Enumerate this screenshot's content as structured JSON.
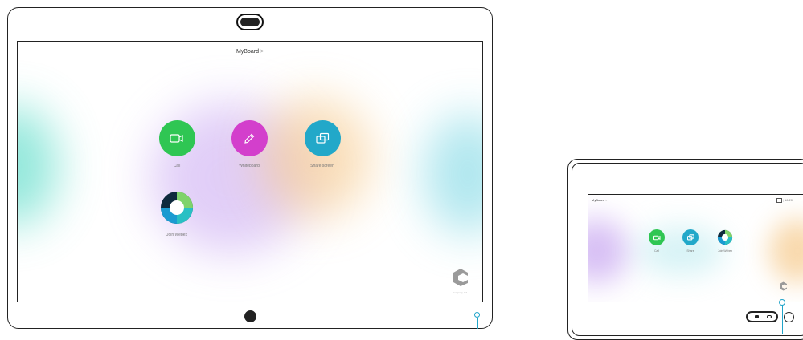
{
  "big_device": {
    "title": "MyBoard",
    "title_chevron": ">",
    "tiles": [
      {
        "label": "Call",
        "icon": "video-camera-icon",
        "color": "#2fc653"
      },
      {
        "label": "Whiteboard",
        "icon": "pencil-icon",
        "color": "#d33fcc"
      },
      {
        "label": "Share screen",
        "icon": "share-screen-icon",
        "color": "#22a8c9"
      },
      {
        "label": "Join Webex",
        "icon": "webex-logo-icon",
        "color": "#1b9bd1"
      }
    ],
    "company_label": "Company Ltd"
  },
  "small_device": {
    "title": "MyBoard",
    "title_chevron": ">",
    "status_time": "16:20",
    "tiles": [
      {
        "label": "Call",
        "icon": "video-camera-icon",
        "color": "#2fc653"
      },
      {
        "label": "Share",
        "icon": "share-screen-icon",
        "color": "#22a8c9"
      },
      {
        "label": "Join Webex",
        "icon": "webex-logo-icon",
        "color": "#1b9bd1"
      }
    ]
  }
}
